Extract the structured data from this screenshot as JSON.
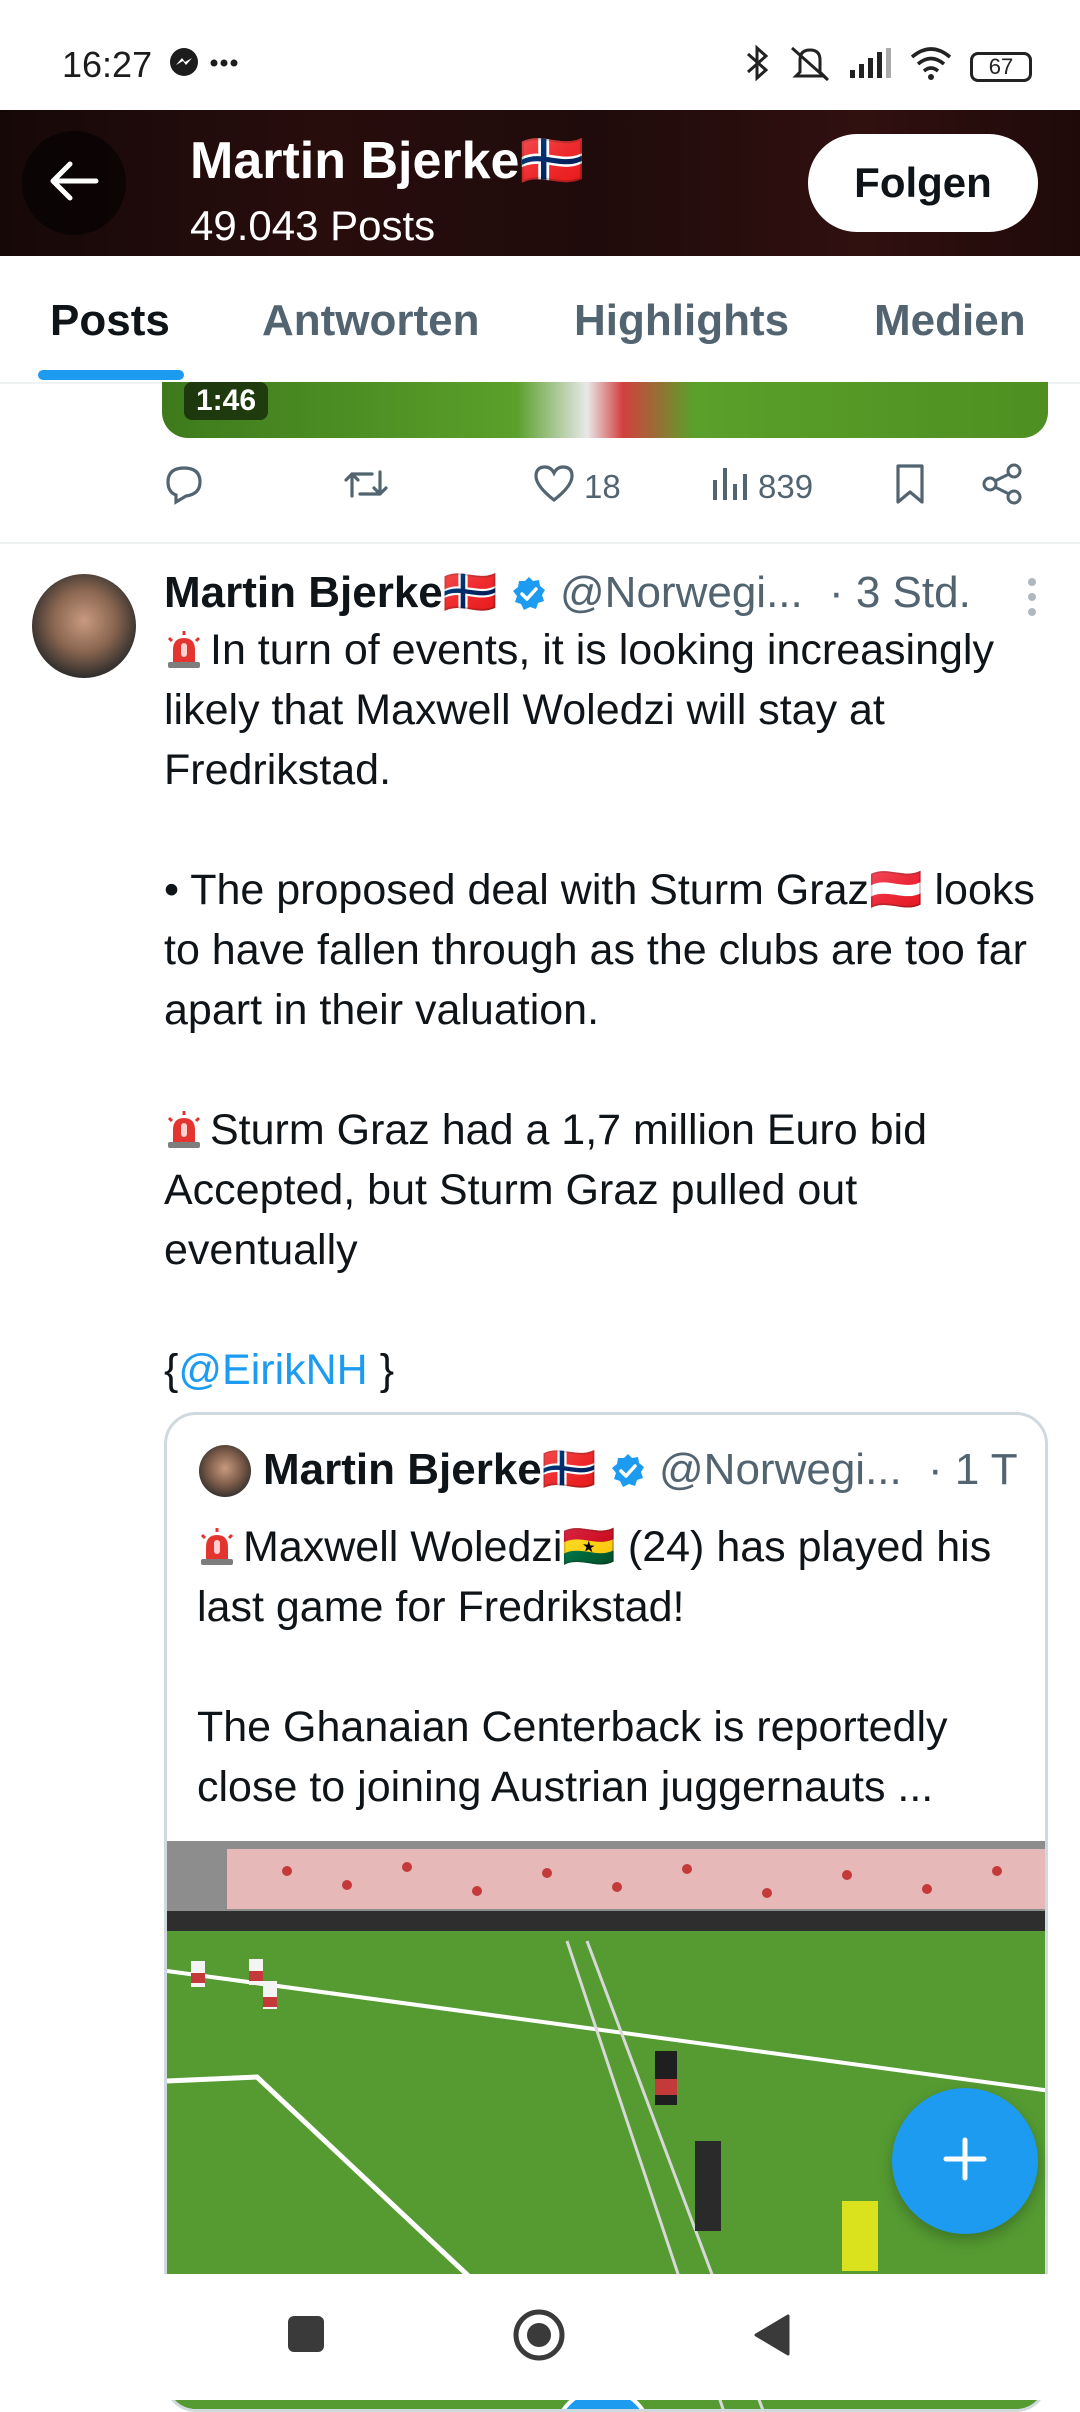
{
  "status_bar": {
    "time": "16:27",
    "battery": "67",
    "ricons": [
      "bluetooth-icon",
      "mute-icon",
      "signal-icon",
      "wifi-icon"
    ]
  },
  "header": {
    "name": "Martin Bjerke🇳🇴",
    "post_count": "49.043 Posts",
    "follow_label": "Folgen"
  },
  "tabs": [
    {
      "label": "Posts",
      "active": true
    },
    {
      "label": "Antworten",
      "active": false
    },
    {
      "label": "Highlights",
      "active": false
    },
    {
      "label": "Medien",
      "active": false
    }
  ],
  "prev_post": {
    "duration": "1:46",
    "likes": "18",
    "views": "839"
  },
  "tweet": {
    "name": "Martin Bjerke🇳🇴",
    "handle": "@Norwegi...",
    "time": "· 3 Std.",
    "p1": "In turn of events, it is looking increasingly likely that Maxwell Woledzi will stay at Fredrikstad.",
    "p2": "• The proposed deal with Sturm Graz🇦🇹 looks to have fallen through as the clubs are too far apart in their valuation.",
    "p3": "Sturm Graz had a 1,7 million Euro bid Accepted, but Sturm Graz pulled out eventually",
    "p4_open": "{",
    "p4_mention": "@EirikNH",
    "p4_close": " }"
  },
  "quote": {
    "name": "Martin Bjerke🇳🇴",
    "handle": "@Norwegi...",
    "time": "· 1 T",
    "p1": "Maxwell Woledzi🇬🇭 (24) has played his last game for Fredrikstad!",
    "p2": "The Ghanaian Centerback is reportedly close to joining Austrian juggernauts ..."
  },
  "colors": {
    "accent": "#1d9bf0",
    "text": "#0f1419",
    "secondary": "#536471"
  }
}
